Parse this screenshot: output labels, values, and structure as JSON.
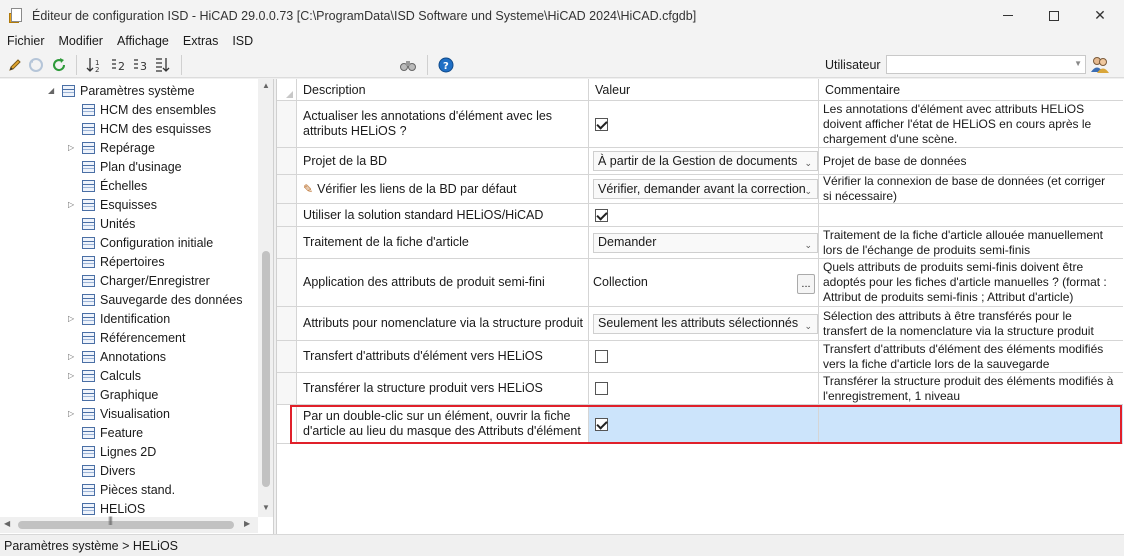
{
  "window": {
    "title": "Éditeur de configuration ISD  -  HiCAD 29.0.0.73 [C:\\ProgramData\\ISD Software und Systeme\\HiCAD 2024\\HiCAD.cfgdb]",
    "minimize": "—",
    "maximize": "☐",
    "close": "✕"
  },
  "menu": [
    "Fichier",
    "Modifier",
    "Affichage",
    "Extras",
    "ISD"
  ],
  "toolbar": {
    "icons": [
      "pencil-icon",
      "undo-icon",
      "refresh-icon",
      "sort-icon",
      "sort-2-icon",
      "sort-3-icon",
      "sort-desc-icon",
      "binoculars-icon",
      "help-icon"
    ],
    "user_label": "Utilisateur",
    "user_value": ""
  },
  "tree": {
    "root": "Paramètres système",
    "items": [
      {
        "label": "HCM des ensembles",
        "expandable": false
      },
      {
        "label": "HCM des esquisses",
        "expandable": false
      },
      {
        "label": "Repérage",
        "expandable": true
      },
      {
        "label": "Plan d'usinage",
        "expandable": false
      },
      {
        "label": "Échelles",
        "expandable": false
      },
      {
        "label": "Esquisses",
        "expandable": true
      },
      {
        "label": "Unités",
        "expandable": false
      },
      {
        "label": "Configuration initiale",
        "expandable": false
      },
      {
        "label": "Répertoires",
        "expandable": false
      },
      {
        "label": "Charger/Enregistrer",
        "expandable": false
      },
      {
        "label": "Sauvegarde des données",
        "expandable": false
      },
      {
        "label": "Identification",
        "expandable": true
      },
      {
        "label": "Référencement",
        "expandable": false
      },
      {
        "label": "Annotations",
        "expandable": true
      },
      {
        "label": "Calculs",
        "expandable": true
      },
      {
        "label": "Graphique",
        "expandable": false
      },
      {
        "label": "Visualisation",
        "expandable": true
      },
      {
        "label": "Feature",
        "expandable": false
      },
      {
        "label": "Lignes 2D",
        "expandable": false
      },
      {
        "label": "Divers",
        "expandable": false
      },
      {
        "label": "Pièces stand.",
        "expandable": false
      },
      {
        "label": "HELiOS",
        "expandable": false
      }
    ]
  },
  "grid": {
    "headers": [
      "Description",
      "Valeur",
      "Commentaire"
    ],
    "rows": [
      {
        "description": "Actualiser les annotations d'élément avec les attributs HELiOS ?",
        "type": "checkbox",
        "checked": true,
        "value": "",
        "comment": "Les annotations d'élément avec attributs HELiOS doivent afficher l'état de HELiOS en cours après le chargement d'une scène."
      },
      {
        "description": "Projet de la BD",
        "type": "dropdown",
        "value": "À partir de la Gestion de documents",
        "comment": "Projet de base de données"
      },
      {
        "description": "Vérifier les liens de la BD par défaut",
        "type": "dropdown",
        "value": "Vérifier, demander avant la correction",
        "comment": "Vérifier la connexion de base de données (et corriger si nécessaire)",
        "edited": true
      },
      {
        "description": "Utiliser la solution standard HELiOS/HiCAD",
        "type": "checkbox",
        "checked": true,
        "value": "",
        "comment": ""
      },
      {
        "description": "Traitement de la fiche d'article",
        "type": "dropdown",
        "value": "Demander",
        "comment": "Traitement de la fiche d'article allouée manuellement lors de l'échange de produits semi-finis"
      },
      {
        "description": "Application des attributs de produit semi-fini",
        "type": "collection",
        "value": "Collection",
        "comment": "Quels attributs de produits semi-finis doivent être adoptés pour les fiches d'article manuelles ? (format : Attribut de produits semi-finis ; Attribut d'article)"
      },
      {
        "description": "Attributs pour nomenclature via la structure produit",
        "type": "dropdown",
        "value": "Seulement les attributs sélectionnés",
        "comment": "Sélection des attributs à être transférés pour le transfert de la nomenclature via la structure produit"
      },
      {
        "description": "Transfert d'attributs d'élément vers HELiOS",
        "type": "checkbox",
        "checked": false,
        "value": "",
        "comment": "Transfert d'attributs d'élément des éléments modifiés vers la fiche d'article lors de la sauvegarde"
      },
      {
        "description": "Transférer la structure produit vers HELiOS",
        "type": "checkbox",
        "checked": false,
        "value": "",
        "comment": "Transférer la structure produit des éléments modifiés à l'enregistrement, 1 niveau"
      },
      {
        "description": "Par un double-clic sur un élément, ouvrir la fiche d'article au lieu du masque des Attributs d'élément",
        "type": "checkbox",
        "checked": true,
        "value": "",
        "comment": "",
        "selected": true
      }
    ]
  },
  "status": "Paramètres système > HELiOS",
  "colors": {
    "selected_row": "#cce4fb",
    "highlight": "#e0202a"
  }
}
